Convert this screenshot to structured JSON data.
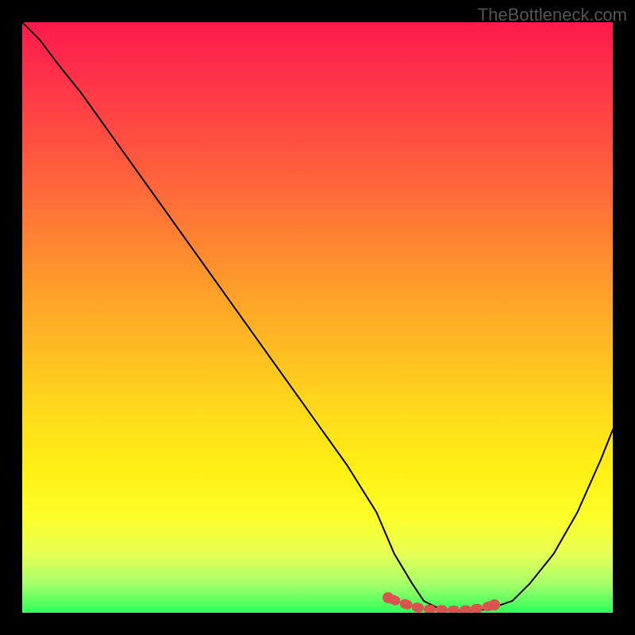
{
  "watermark": "TheBottleneck.com",
  "chart_data": {
    "type": "line",
    "title": "",
    "xlabel": "",
    "ylabel": "",
    "xlim": [
      0,
      100
    ],
    "ylim": [
      0,
      100
    ],
    "series": [
      {
        "name": "curve",
        "x": [
          0,
          3,
          6,
          10,
          15,
          20,
          25,
          30,
          35,
          40,
          45,
          50,
          55,
          60,
          63,
          66,
          68,
          70,
          72,
          74,
          76,
          78,
          80,
          83,
          86,
          90,
          94,
          98,
          100
        ],
        "y": [
          100,
          97,
          93,
          88,
          81,
          74,
          67,
          60,
          53,
          46,
          39,
          32,
          25,
          17,
          10,
          5,
          2,
          1,
          0.5,
          0.3,
          0.3,
          0.5,
          1,
          2,
          5,
          10,
          17,
          26,
          31
        ]
      },
      {
        "name": "highlight",
        "x": [
          62,
          64,
          66,
          68,
          70,
          72,
          74,
          76,
          78,
          80
        ],
        "y": [
          2.5,
          1.7,
          1.1,
          0.7,
          0.5,
          0.4,
          0.4,
          0.5,
          0.8,
          1.4
        ]
      }
    ],
    "highlight_color": "#d9534f",
    "gradient_stops": [
      {
        "pos": 0,
        "color": "#ff1a4d"
      },
      {
        "pos": 50,
        "color": "#ffbe22"
      },
      {
        "pos": 85,
        "color": "#fcff2a"
      },
      {
        "pos": 100,
        "color": "#2eff5a"
      }
    ]
  }
}
